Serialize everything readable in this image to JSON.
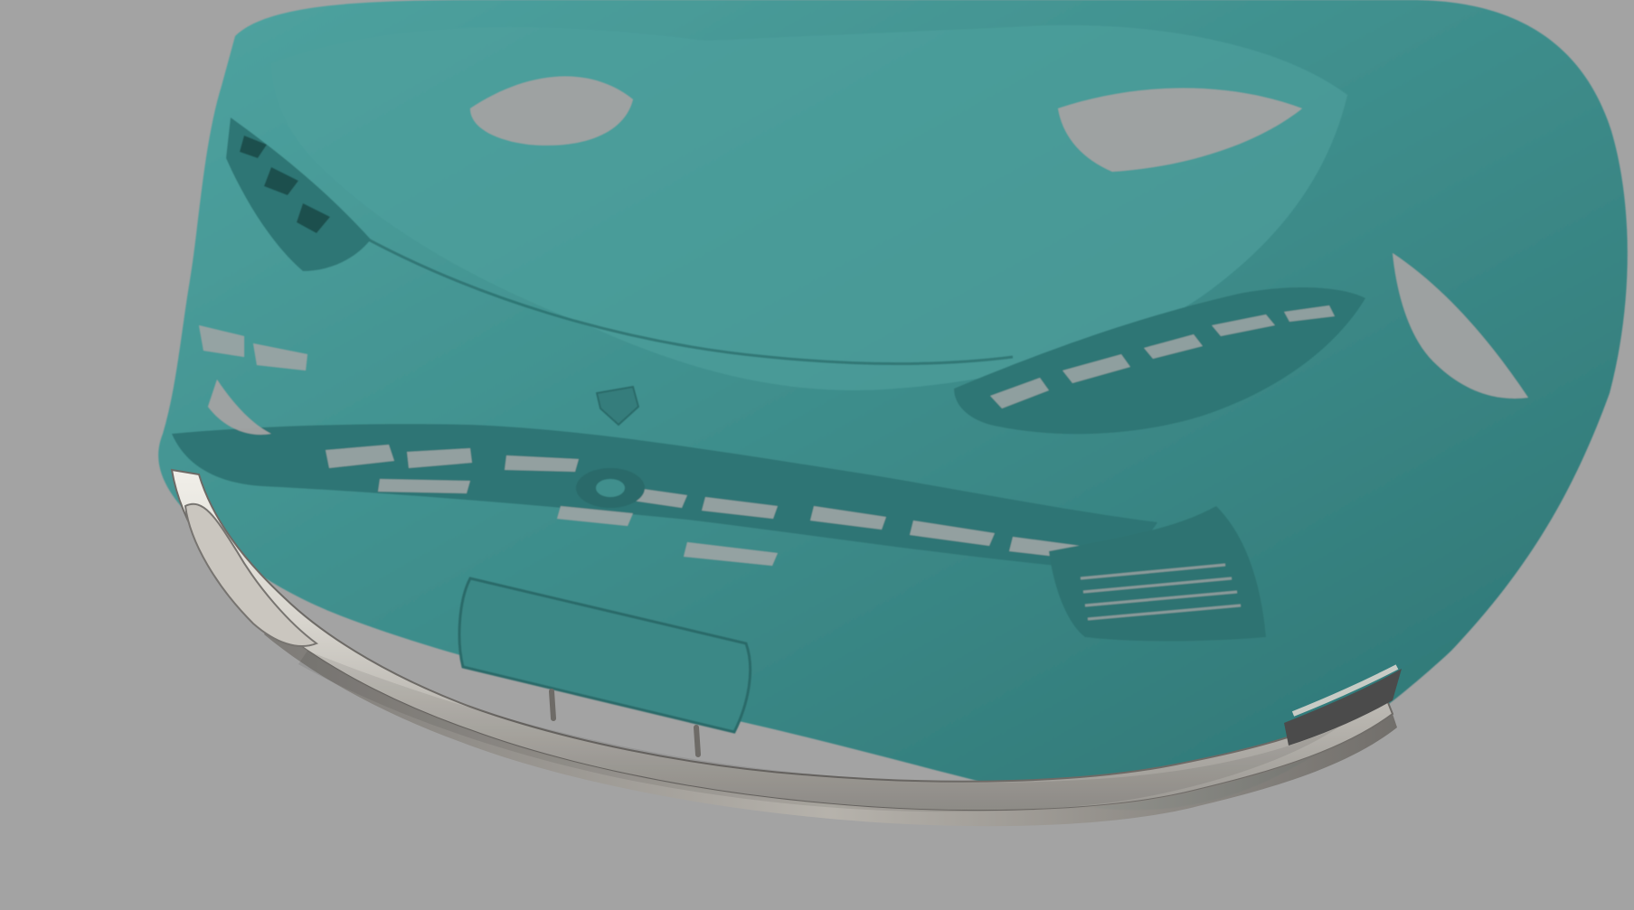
{
  "viewport": {
    "background_color": "#a3a3a3",
    "scan_mesh_color": "#3f8f8d",
    "scan_mesh_highlight": "#5fb0ac",
    "scan_mesh_shadow": "#2b6f6e",
    "body_kit_color": "#d6d3cc",
    "body_kit_shadow": "#8f8c87",
    "body_kit_dark": "#4b4b4b"
  }
}
